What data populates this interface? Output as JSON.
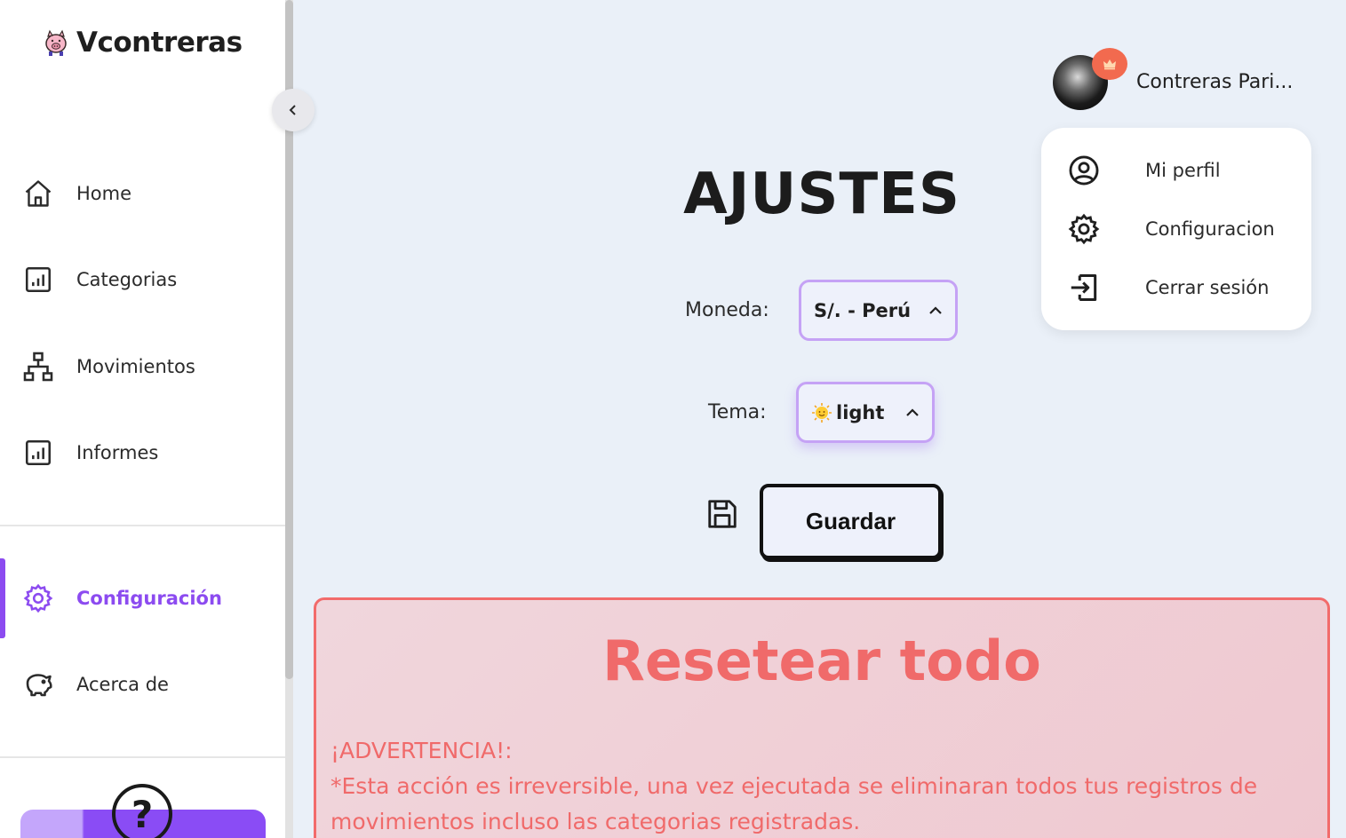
{
  "brand": {
    "name": "Vcontreras",
    "logo_icon": "pig-icon"
  },
  "sidebar": {
    "items": [
      {
        "label": "Home",
        "icon": "home-icon"
      },
      {
        "label": "Categorias",
        "icon": "chart-icon"
      },
      {
        "label": "Movimientos",
        "icon": "hierarchy-icon"
      },
      {
        "label": "Informes",
        "icon": "chart-icon"
      },
      {
        "label": "Configuración",
        "icon": "gear-icon",
        "active": true
      },
      {
        "label": "Acerca de",
        "icon": "piggy-bank-icon"
      }
    ],
    "help_symbol": "?"
  },
  "header": {
    "user_name": "Contreras Pari...",
    "badge_icon": "crown-icon"
  },
  "user_menu": {
    "items": [
      {
        "label": "Mi perfil",
        "icon": "user-circle-icon"
      },
      {
        "label": "Configuracion",
        "icon": "gear-icon"
      },
      {
        "label": "Cerrar sesión",
        "icon": "logout-icon"
      }
    ]
  },
  "settings": {
    "title": "AJUSTES",
    "currency_label": "Moneda:",
    "currency_value": "S/. - Perú",
    "theme_label": "Tema:",
    "theme_value": "light",
    "save_label": "Guardar"
  },
  "reset": {
    "title": "Resetear todo",
    "warning_heading": "¡ADVERTENCIA!:",
    "warning_text": "*Esta acción es irreversible, una vez ejecutada se eliminaran todos tus registros de movimientos incluso las categorias registradas."
  },
  "colors": {
    "accent": "#8c4bf0",
    "danger": "#f06a6a",
    "background": "#eaf0f8"
  }
}
